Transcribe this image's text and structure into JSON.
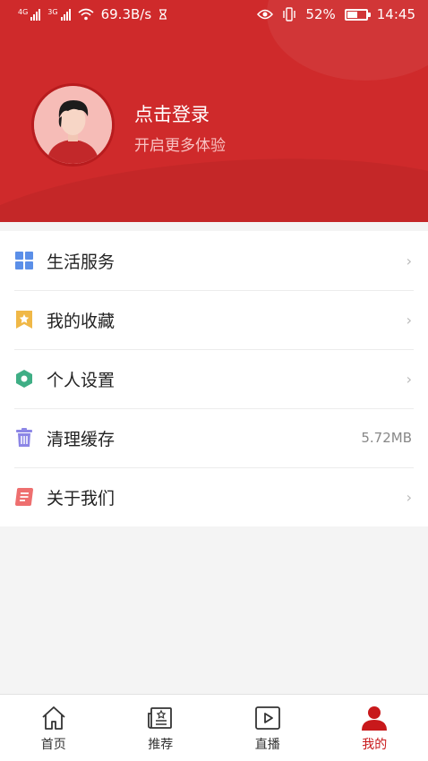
{
  "status_bar": {
    "network1": "4G",
    "network2": "3G",
    "speed": "69.3B/s",
    "battery_percent": "52%",
    "battery_level": 0.52,
    "time": "14:45"
  },
  "profile": {
    "title": "点击登录",
    "subtitle": "开启更多体验"
  },
  "menu": {
    "items": [
      {
        "label": "生活服务",
        "icon": "grid-icon",
        "color": "#5b8fe8"
      },
      {
        "label": "我的收藏",
        "icon": "star-bookmark-icon",
        "color": "#f0b847"
      },
      {
        "label": "个人设置",
        "icon": "hexagon-settings-icon",
        "color": "#3fae85"
      },
      {
        "label": "清理缓存",
        "icon": "trash-icon",
        "color": "#8c86e6",
        "value": "5.72MB"
      },
      {
        "label": "关于我们",
        "icon": "document-icon",
        "color": "#ee6f6f"
      }
    ],
    "arrow": "›"
  },
  "bottom_nav": {
    "items": [
      {
        "label": "首页",
        "icon": "home-icon"
      },
      {
        "label": "推荐",
        "icon": "news-icon"
      },
      {
        "label": "直播",
        "icon": "play-icon"
      },
      {
        "label": "我的",
        "icon": "user-icon",
        "active": true
      }
    ]
  },
  "colors": {
    "brand_red": "#cf2a2b",
    "active_tab": "#c8191b"
  }
}
